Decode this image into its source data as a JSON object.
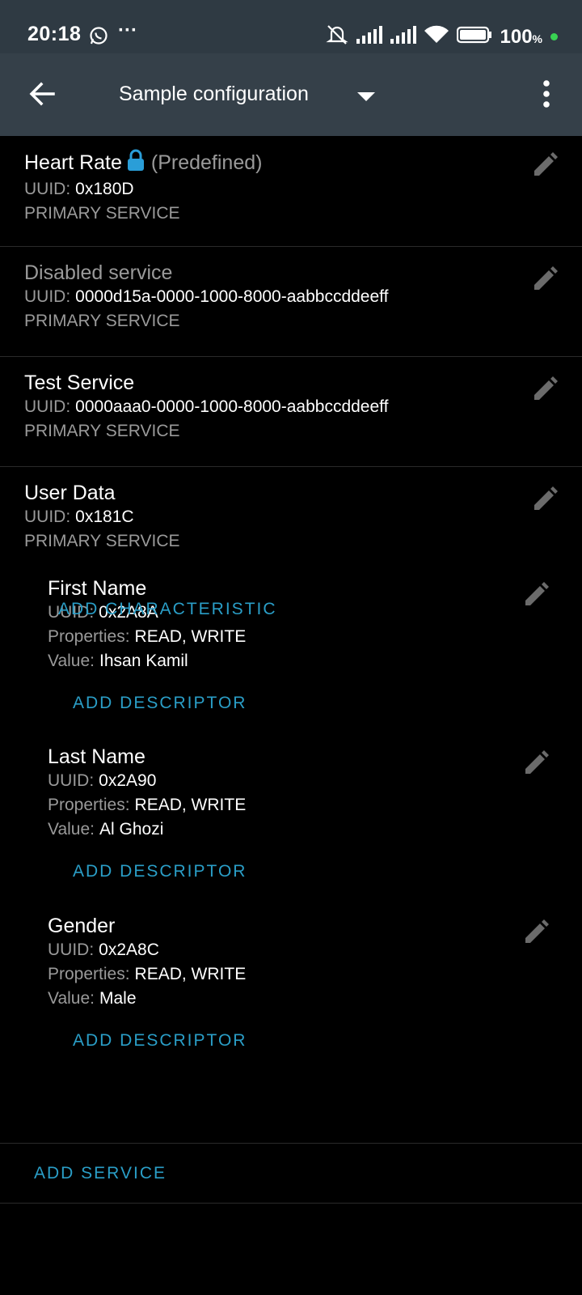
{
  "status_bar": {
    "time": "20:18",
    "battery": "100",
    "battery_unit": "%"
  },
  "app_bar": {
    "title": "Sample configuration",
    "icons": [
      "back-arrow-icon",
      "dropdown-arrow-icon",
      "more-vert-icon"
    ]
  },
  "labels": {
    "uuid": "UUID:",
    "properties": "Properties:",
    "value": "Value:",
    "primary_service": "PRIMARY SERVICE",
    "predefined": "(Predefined)",
    "add_descriptor": "ADD DESCRIPTOR",
    "add_characteristic": "ADD CHARACTERISTIC",
    "add_service": "ADD SERVICE"
  },
  "services": [
    {
      "name": "Heart Rate",
      "uuid": "0x180D",
      "type": "PRIMARY SERVICE"
    },
    {
      "name": "Disabled service",
      "uuid": "0000d15a-0000-1000-8000-aabbccddeeff",
      "type": "PRIMARY SERVICE"
    },
    {
      "name": "Test Service",
      "uuid": "0000aaa0-0000-1000-8000-aabbccddeeff",
      "type": "PRIMARY SERVICE"
    },
    {
      "name": "User Data",
      "uuid": "0x181C",
      "type": "PRIMARY SERVICE"
    }
  ],
  "characteristics": [
    {
      "name": "First Name",
      "uuid": "0x2A8A",
      "properties": "READ, WRITE",
      "value": "Ihsan Kamil"
    },
    {
      "name": "Last Name",
      "uuid": "0x2A90",
      "properties": "READ, WRITE",
      "value": "Al Ghozi"
    },
    {
      "name": "Gender",
      "uuid": "0x2A8C",
      "properties": "READ, WRITE",
      "value": "Male"
    }
  ],
  "colors": {
    "status_bar_bg": "#2f3a43",
    "app_bar_bg": "#354049",
    "accent": "#2a9ec7",
    "lock_icon": "#2a9ed8",
    "background": "#000000"
  }
}
